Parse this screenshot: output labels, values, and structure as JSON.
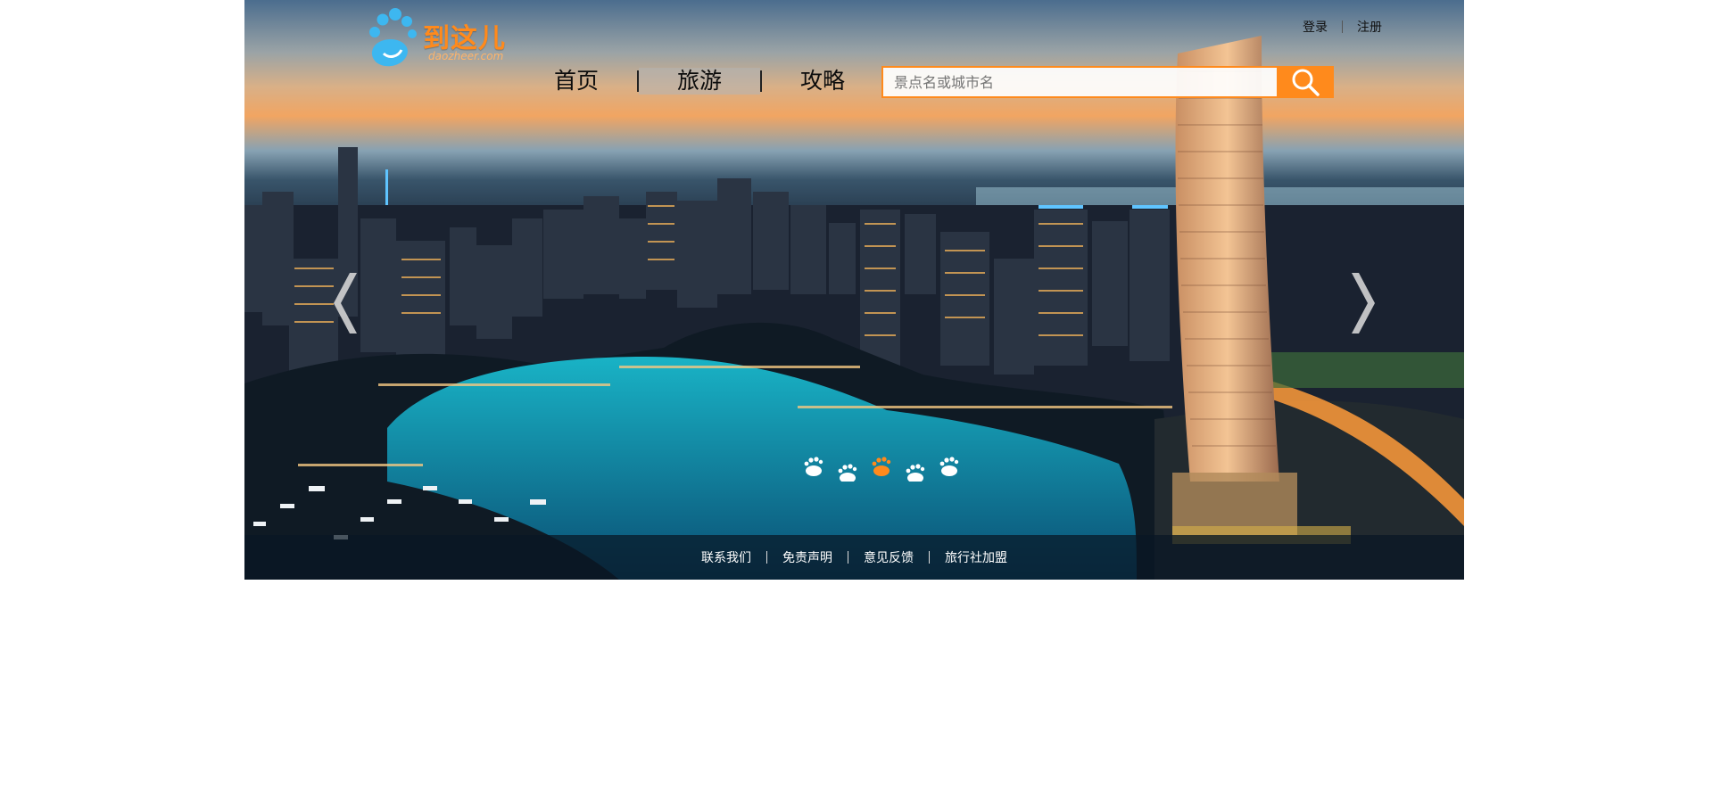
{
  "logo": {
    "name": "到这儿",
    "domain": "daozheer.com"
  },
  "auth": {
    "login": "登录",
    "register": "注册"
  },
  "nav": [
    {
      "label": "首页",
      "active": false
    },
    {
      "label": "旅游",
      "active": true
    },
    {
      "label": "攻略",
      "active": false
    }
  ],
  "search": {
    "placeholder": "景点名或城市名",
    "button_icon": "search-icon"
  },
  "carousel": {
    "prev_icon": "chevron-left-icon",
    "next_icon": "chevron-right-icon",
    "slide_count": 5,
    "active_index": 2,
    "indicator_icon": "footprint-icon"
  },
  "footer": {
    "links": [
      "联系我们",
      "免责声明",
      "意见反馈",
      "旅行社加盟"
    ]
  },
  "colors": {
    "accent": "#ff8a1c",
    "logo_blue": "#3db7f0",
    "footer_bg": "#08162a"
  }
}
